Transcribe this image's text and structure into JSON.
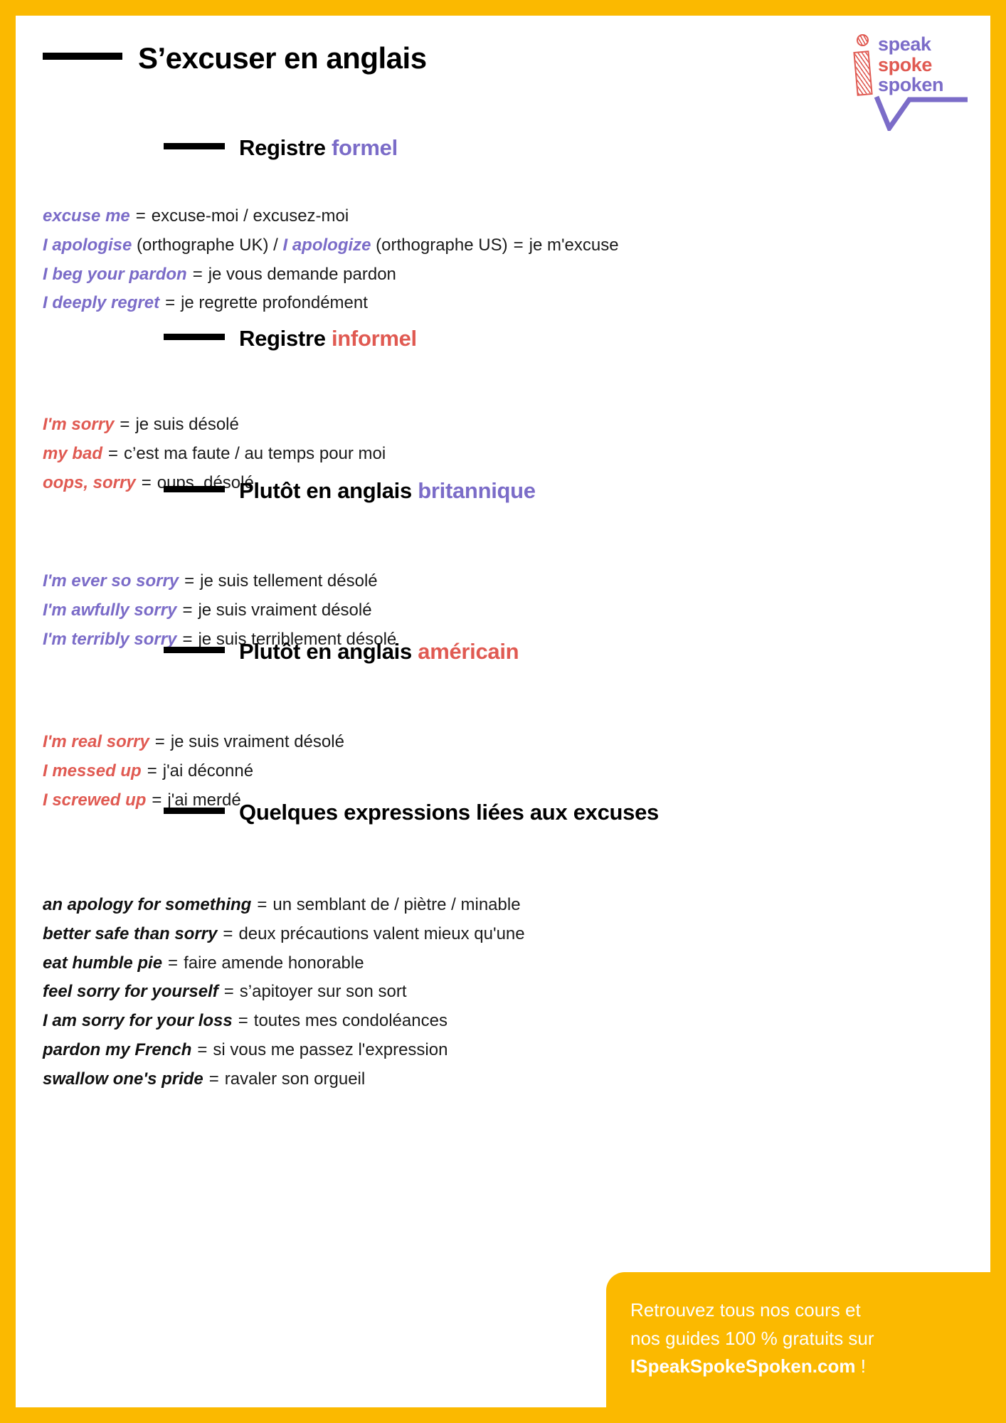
{
  "colors": {
    "brand_yellow": "#FBB900",
    "purple": "#7B6CC8",
    "red": "#E05A52",
    "black": "#111111",
    "white": "#FFFFFF"
  },
  "logo": {
    "line1": "speak",
    "line2": "spoke",
    "line3": "spoken"
  },
  "header": {
    "title": "S’excuser en anglais"
  },
  "sections": [
    {
      "id": "formel",
      "head_plain": "Registre ",
      "head_accent": "formel",
      "accent": "purple",
      "rows": [
        {
          "en": "excuse me",
          "fr": "excuse-moi / excusez-moi"
        },
        {
          "en": "I apologise",
          "en_note": "(orthographe UK)",
          "sep": "/",
          "en2": "I apologize",
          "en2_note": "(orthographe US)",
          "fr": "je m'excuse"
        },
        {
          "en": "I beg your pardon",
          "fr": "je vous demande pardon"
        },
        {
          "en": "I deeply regret",
          "fr": "je regrette profondément"
        }
      ]
    },
    {
      "id": "informel",
      "head_plain": "Registre ",
      "head_accent": "informel",
      "accent": "red",
      "rows": [
        {
          "en": "I'm sorry",
          "fr": "je suis désolé"
        },
        {
          "en": "my bad",
          "fr": "c’est ma faute / au temps pour moi"
        },
        {
          "en": "oops, sorry",
          "fr": "oups, désolé"
        }
      ]
    },
    {
      "id": "britannique",
      "head_plain": "Plutôt en anglais ",
      "head_accent": "britannique",
      "accent": "purple",
      "rows": [
        {
          "en": "I'm ever so sorry",
          "fr": "je suis tellement désolé"
        },
        {
          "en": "I'm awfully sorry",
          "fr": "je suis vraiment désolé"
        },
        {
          "en": "I'm terribly sorry",
          "fr": "je suis terriblement désolé"
        }
      ]
    },
    {
      "id": "americain",
      "head_plain": "Plutôt en anglais ",
      "head_accent": "américain",
      "accent": "red",
      "rows": [
        {
          "en": "I'm real sorry",
          "fr": "je suis vraiment désolé"
        },
        {
          "en": "I messed up",
          "fr": "j'ai déconné"
        },
        {
          "en": "I screwed up",
          "fr": "j'ai merdé"
        }
      ]
    },
    {
      "id": "expressions",
      "head_plain": "Quelques expressions liées aux excuses",
      "head_accent": "",
      "accent": "black",
      "rows": [
        {
          "en": "an apology for something",
          "fr": "un semblant de / piètre / minable"
        },
        {
          "en": "better safe than sorry",
          "fr": "deux précautions valent mieux qu'une"
        },
        {
          "en": "eat humble pie",
          "fr": "faire amende honorable"
        },
        {
          "en": "feel sorry for yourself",
          "fr": "s’apitoyer sur son sort"
        },
        {
          "en": "I am sorry for your loss",
          "fr": "toutes mes condoléances"
        },
        {
          "en": "pardon my French",
          "fr": "si vous me passez l'expression"
        },
        {
          "en": "swallow one's pride",
          "fr": "ravaler son orgueil"
        }
      ]
    }
  ],
  "equals": "=",
  "footer": {
    "line1": "Retrouvez tous nos cours et",
    "line2": "nos guides 100 % gratuits sur",
    "site": "ISpeakSpokeSpoken.com",
    "exclaim": "!"
  }
}
